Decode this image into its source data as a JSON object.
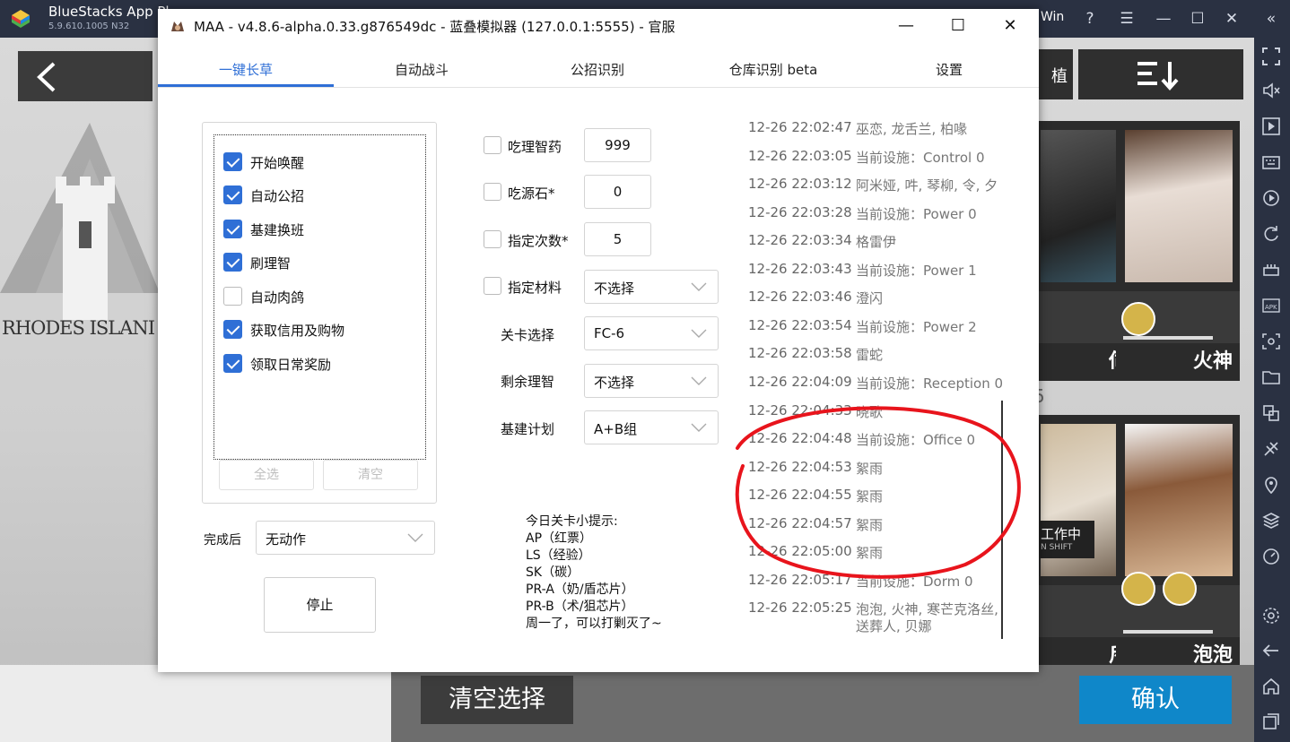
{
  "bluestacks": {
    "title": "BlueStacks App Pl",
    "version": "5.9.610.1005  N32",
    "win_label": "Win"
  },
  "game": {
    "rhodes_text": "RHODES ISLANI",
    "clear_selection": "清空选择",
    "confirm": "确认",
    "sort_partial": "植",
    "operators": [
      {
        "name": "伺夜"
      },
      {
        "name": "火神"
      },
      {
        "name": "斥罪"
      },
      {
        "name": "泡泡"
      }
    ],
    "working_badge": "工作中",
    "working_sub": "N SHIFT",
    "card_number": "5"
  },
  "maa": {
    "title": "MAA - v4.8.6-alpha.0.33.g876549dc - 蓝叠模拟器 (127.0.0.1:5555) - 官服",
    "tabs": [
      "一键长草",
      "自动战斗",
      "公招识别",
      "仓库识别 beta",
      "设置"
    ],
    "active_tab": 0,
    "tasks": [
      {
        "label": "开始唤醒",
        "checked": true
      },
      {
        "label": "自动公招",
        "checked": true
      },
      {
        "label": "基建换班",
        "checked": true
      },
      {
        "label": "刷理智",
        "checked": true
      },
      {
        "label": "自动肉鸽",
        "checked": false
      },
      {
        "label": "获取信用及购物",
        "checked": true
      },
      {
        "label": "领取日常奖励",
        "checked": true
      }
    ],
    "select_all": "全选",
    "clear": "清空",
    "after_label": "完成后",
    "after_value": "无动作",
    "stop": "停止",
    "options": {
      "medicine_label": "吃理智药",
      "medicine_value": "999",
      "stone_label": "吃源石*",
      "stone_value": "0",
      "times_label": "指定次数*",
      "times_value": "5",
      "material_label": "指定材料",
      "material_value": "不选择",
      "stage_label": "关卡选择",
      "stage_value": "FC-6",
      "remain_label": "剩余理智",
      "remain_value": "不选择",
      "plan_label": "基建计划",
      "plan_value": "A+B组"
    },
    "tips": [
      "今日关卡小提示:",
      "AP（红票）",
      "LS（经验）",
      "SK（碳）",
      "PR-A（奶/盾芯片）",
      "PR-B（术/狙芯片）",
      "周一了，可以打剿灭了~"
    ],
    "log": [
      {
        "time": "12-26  22:02:47",
        "msg": "巫恋, 龙舌兰, 柏喙"
      },
      {
        "time": "12-26  22:03:05",
        "msg": "当前设施：Control 0"
      },
      {
        "time": "12-26  22:03:12",
        "msg": "阿米娅, 吽, 琴柳, 令, 夕"
      },
      {
        "time": "12-26  22:03:28",
        "msg": "当前设施：Power 0"
      },
      {
        "time": "12-26  22:03:34",
        "msg": "格雷伊"
      },
      {
        "time": "12-26  22:03:43",
        "msg": "当前设施：Power 1"
      },
      {
        "time": "12-26  22:03:46",
        "msg": "澄闪"
      },
      {
        "time": "12-26  22:03:54",
        "msg": "当前设施：Power 2"
      },
      {
        "time": "12-26  22:03:58",
        "msg": "雷蛇"
      },
      {
        "time": "12-26  22:04:09",
        "msg": "当前设施：Reception 0"
      },
      {
        "time": "12-26  22:04:33",
        "msg": "晓歌"
      },
      {
        "time": "12-26  22:04:48",
        "msg": "当前设施：Office 0"
      },
      {
        "time": "12-26  22:04:53",
        "msg": "絮雨"
      },
      {
        "time": "12-26  22:04:55",
        "msg": "絮雨"
      },
      {
        "time": "12-26  22:04:57",
        "msg": "絮雨"
      },
      {
        "time": "12-26  22:05:00",
        "msg": "絮雨"
      },
      {
        "time": "12-26  22:05:17",
        "msg": "当前设施：Dorm 0"
      },
      {
        "time": "12-26  22:05:25",
        "msg": "泡泡, 火神, 寒芒克洛丝,",
        "msg2": "送葬人, 贝娜"
      }
    ]
  }
}
